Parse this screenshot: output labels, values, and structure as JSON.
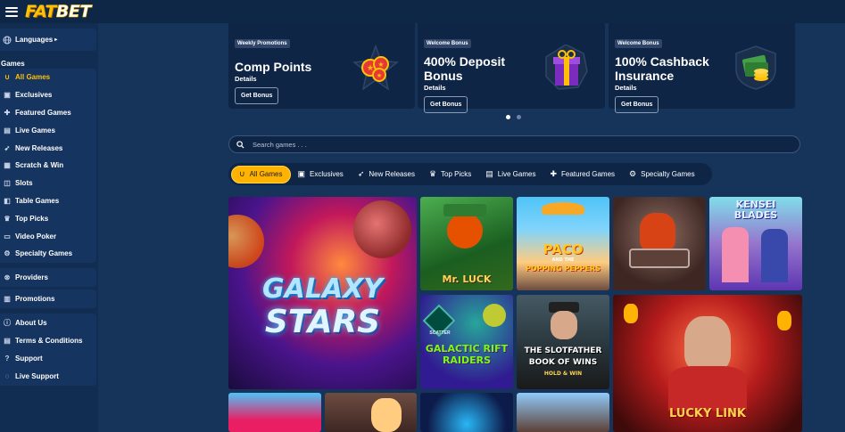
{
  "header": {
    "logo_part1": "FAT",
    "logo_part2": "BET"
  },
  "sidebar": {
    "languages_label": "Languages",
    "games_heading": "Games",
    "games": [
      {
        "label": "All Games",
        "icon": "horseshoe-icon",
        "active": true
      },
      {
        "label": "Exclusives",
        "icon": "exclusive-icon"
      },
      {
        "label": "Featured Games",
        "icon": "puzzle-icon"
      },
      {
        "label": "Live Games",
        "icon": "cards-icon"
      },
      {
        "label": "New Releases",
        "icon": "rocket-icon"
      },
      {
        "label": "Scratch & Win",
        "icon": "ticket-icon"
      },
      {
        "label": "Slots",
        "icon": "slot-icon"
      },
      {
        "label": "Table Games",
        "icon": "table-icon"
      },
      {
        "label": "Top Picks",
        "icon": "trophy-icon"
      },
      {
        "label": "Video Poker",
        "icon": "poker-icon"
      },
      {
        "label": "Specialty Games",
        "icon": "gear-icon"
      }
    ],
    "providers_label": "Providers",
    "promotions_label": "Promotions",
    "info": [
      {
        "label": "About Us",
        "icon": "info-icon"
      },
      {
        "label": "Terms & Conditions",
        "icon": "document-icon"
      },
      {
        "label": "Support",
        "icon": "help-icon"
      },
      {
        "label": "Live Support",
        "icon": "chat-icon"
      }
    ]
  },
  "promos": [
    {
      "tag": "Weekly Promotions",
      "title": "Comp Points",
      "details": "Details",
      "button": "Get Bonus"
    },
    {
      "tag": "Welcome Bonus",
      "title": "400% Deposit Bonus",
      "details": "Details",
      "button": "Get Bonus"
    },
    {
      "tag": "Welcome Bonus",
      "title": "100% Cashback Insurance",
      "details": "Details",
      "button": "Get Bonus"
    }
  ],
  "search": {
    "placeholder": "Search games . . ."
  },
  "categories": [
    {
      "label": "All Games",
      "icon": "horseshoe-icon",
      "active": true
    },
    {
      "label": "Exclusives",
      "icon": "exclusive-icon"
    },
    {
      "label": "New Releases",
      "icon": "rocket-icon"
    },
    {
      "label": "Top Picks",
      "icon": "trophy-icon"
    },
    {
      "label": "Live Games",
      "icon": "cards-icon"
    },
    {
      "label": "Featured Games",
      "icon": "puzzle-icon"
    },
    {
      "label": "Specialty Games",
      "icon": "gear-icon"
    }
  ],
  "games": {
    "galaxy": {
      "line1": "GALAXY",
      "line2": "STARS"
    },
    "mrluck": {
      "title": "Mr. LUCK"
    },
    "paco": {
      "line1": "PACO",
      "line2": "AND THE",
      "line3": "POPPING PEPPERS"
    },
    "kenji": {
      "line1": "KENSEI",
      "line2": "BLADES"
    },
    "galactic": {
      "line1": "GALACTIC RIFT",
      "line2": "RAIDERS",
      "badge": "SCATTER"
    },
    "slotfather": {
      "line1": "THE SLOTFATHER",
      "line2": "BOOK OF WINS",
      "line3": "HOLD & WIN"
    },
    "lucky": {
      "line1": "LUCKY LINK"
    }
  }
}
